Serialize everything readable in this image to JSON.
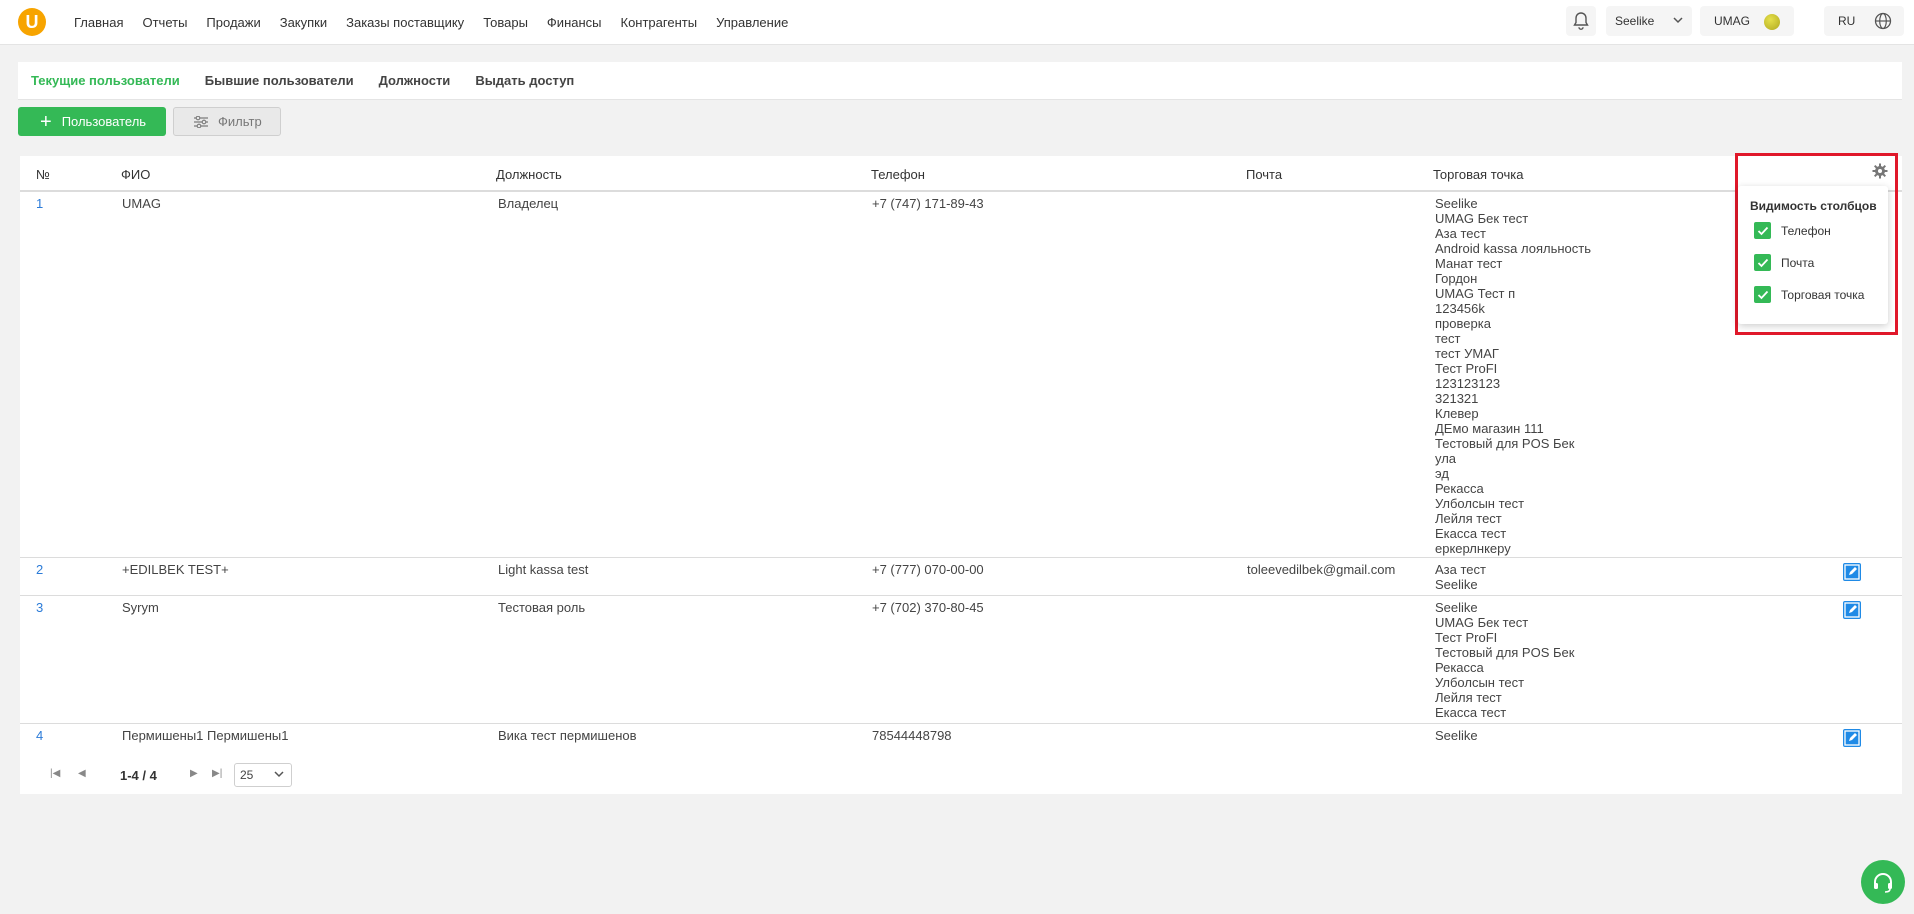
{
  "logo": {
    "letter": "U"
  },
  "nav": [
    "Главная",
    "Отчеты",
    "Продажи",
    "Закупки",
    "Заказы поставщику",
    "Товары",
    "Финансы",
    "Контрагенты",
    "Управление"
  ],
  "header": {
    "store": "Seelike",
    "user": "UMAG",
    "lang": "RU"
  },
  "tabs": [
    "Текущие пользователи",
    "Бывшие пользователи",
    "Должности",
    "Выдать доступ"
  ],
  "toolbar": {
    "add_label": "Пользователь",
    "filter_label": "Фильтр"
  },
  "table": {
    "headers": [
      "№",
      "ФИО",
      "Должность",
      "Телефон",
      "Почта",
      "Торговая точка"
    ],
    "rows": [
      {
        "num": "1",
        "name": "UMAG",
        "position": "Владелец",
        "phone": "+7 (747) 171-89-43",
        "email": "",
        "points": [
          "Seelike",
          "UMAG Бек тест",
          "Аза тест",
          "Android kassa лояльность",
          "Манат тест",
          "Гордон",
          "UMAG Тест п",
          "123456k",
          "проверка",
          "тест",
          "тест УМАГ",
          "Тест ProFI",
          "123123123",
          "321321",
          "Клевер",
          "ДЕмо магазин 111",
          "Тестовый для POS Бек",
          "ула",
          "эд",
          "Рекасса",
          "Улболсын тест",
          "Лейля тест",
          "Екасса тест",
          "еркерлнкеру"
        ]
      },
      {
        "num": "2",
        "name": "+EDILBEK TEST+",
        "position": "Light kassa test",
        "phone": "+7 (777) 070-00-00",
        "email": "toleevedilbek@gmail.com",
        "points": [
          "Аза тест",
          "Seelike"
        ]
      },
      {
        "num": "3",
        "name": "Syrym",
        "position": "Тестовая роль",
        "phone": "+7 (702) 370-80-45",
        "email": "",
        "points": [
          "Seelike",
          "UMAG Бек тест",
          "Тест ProFI",
          "Тестовый для POS Бек",
          "Рекасса",
          "Улболсын тест",
          "Лейля тест",
          "Екасса тест"
        ]
      },
      {
        "num": "4",
        "name": "Пермишены1 Пермишены1",
        "position": "Вика тест пермишенов",
        "phone": "78544448798",
        "email": "",
        "points": [
          "Seelike"
        ]
      }
    ]
  },
  "pager": {
    "range": "1-4 / 4",
    "page_size": "25"
  },
  "column_visibility": {
    "title": "Видимость столбцов",
    "items": [
      {
        "label": "Телефон",
        "checked": true
      },
      {
        "label": "Почта",
        "checked": true
      },
      {
        "label": "Торговая точка",
        "checked": true
      }
    ]
  }
}
